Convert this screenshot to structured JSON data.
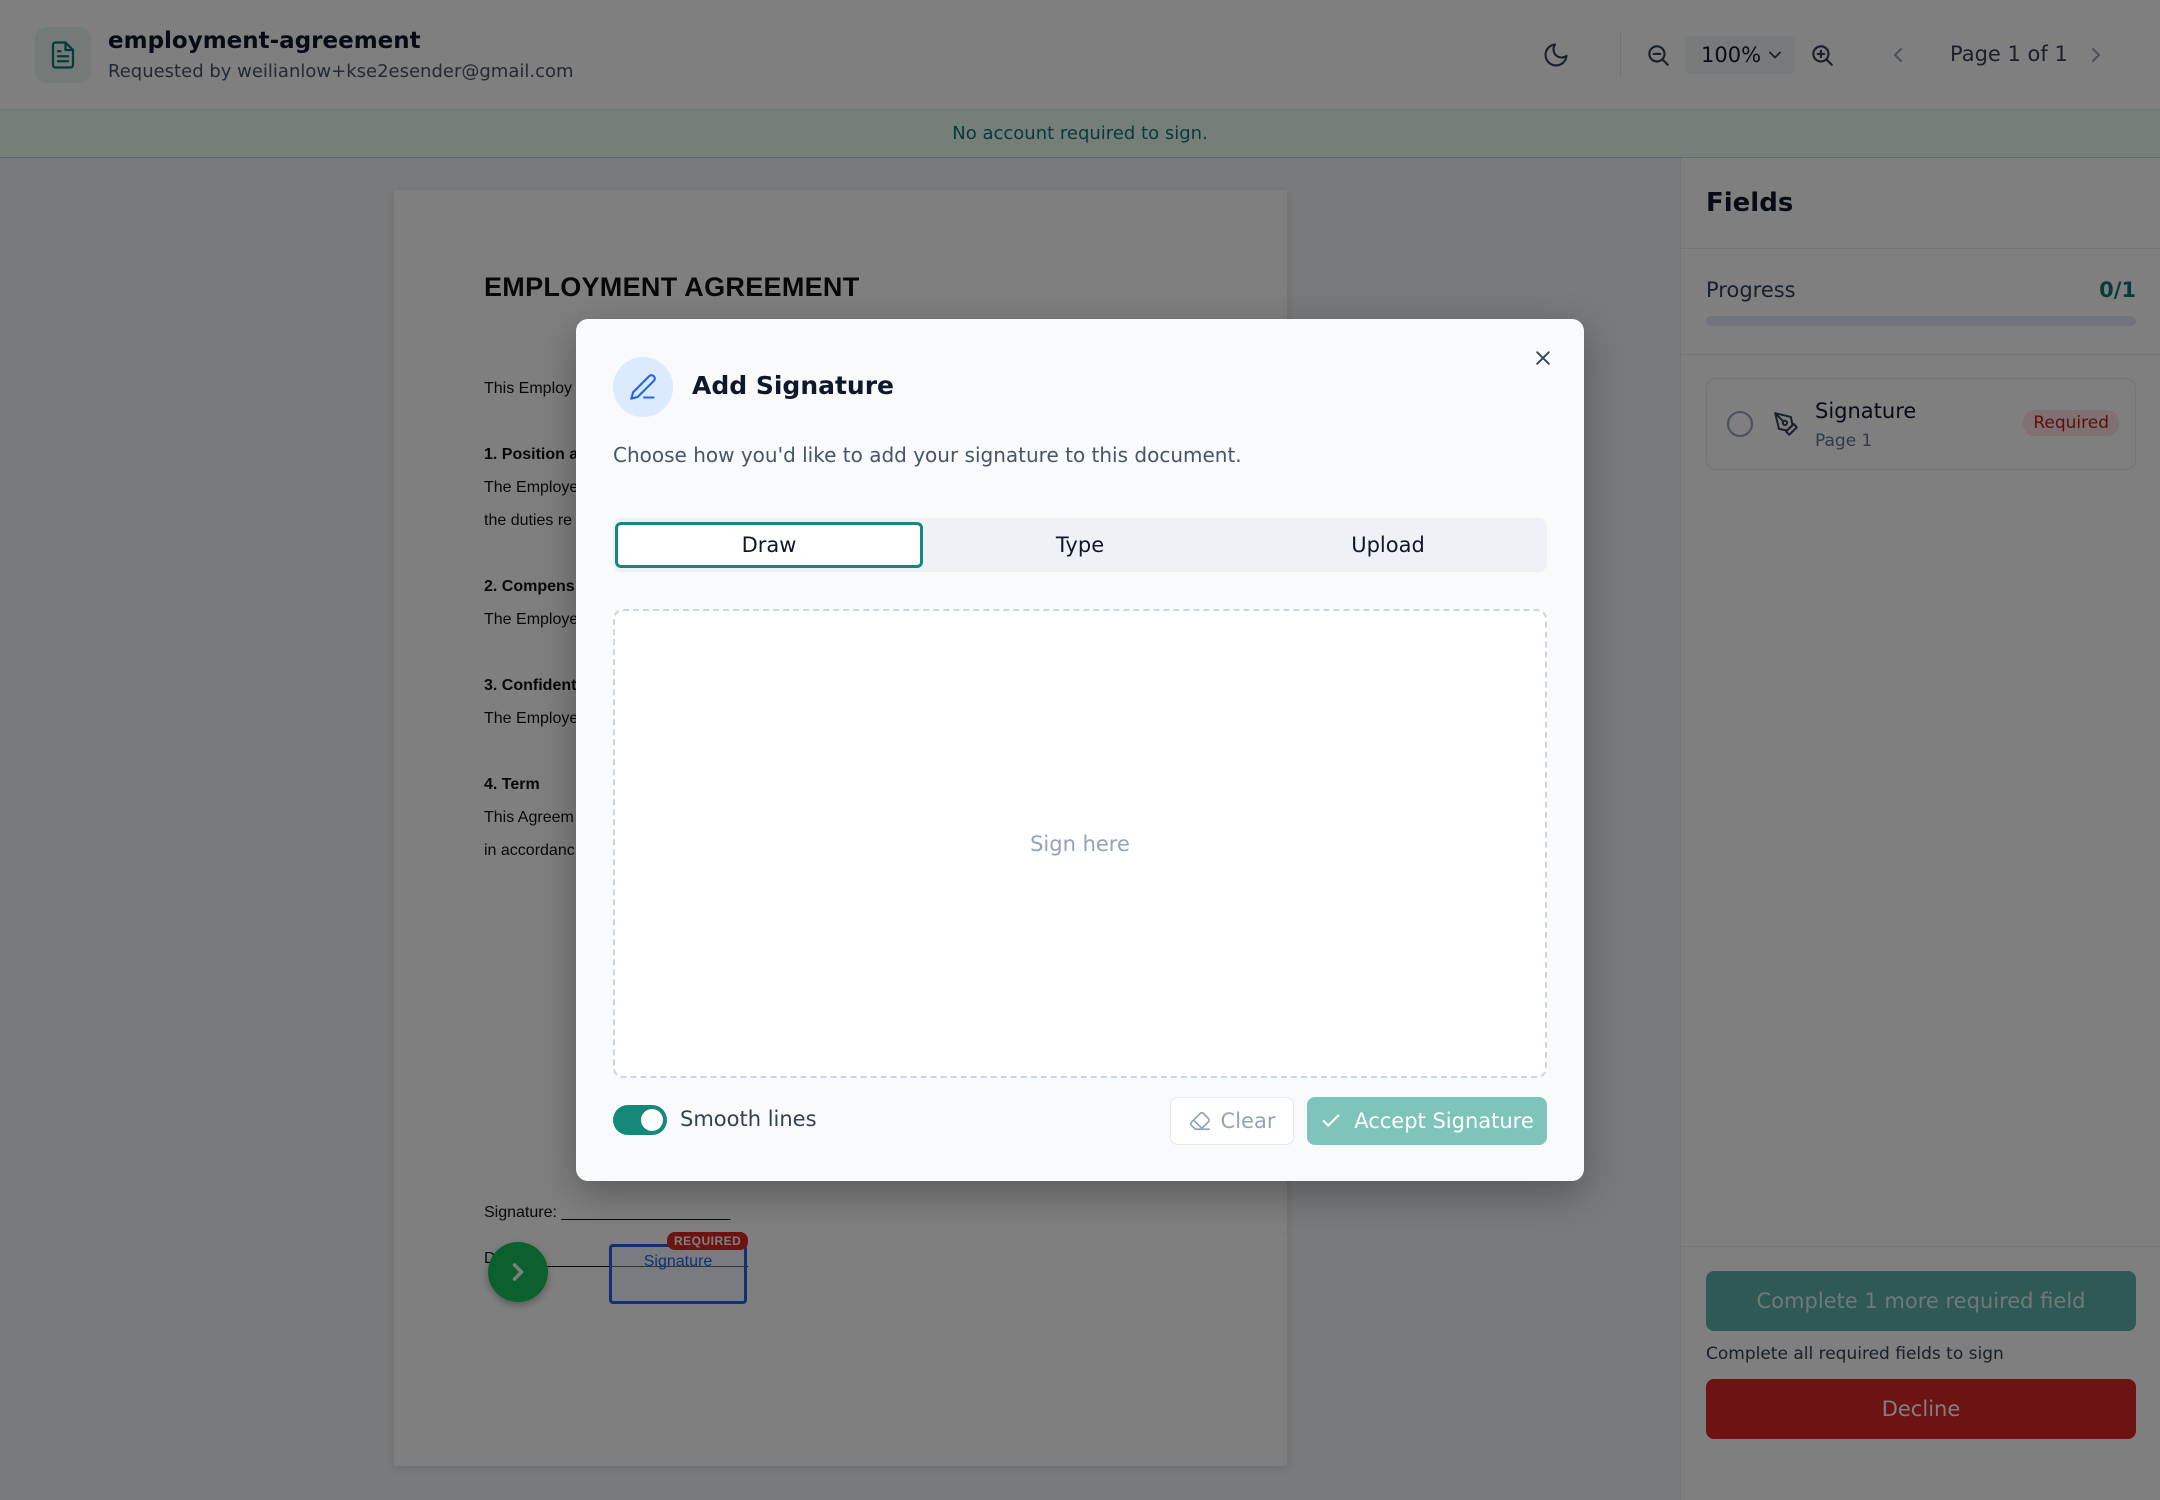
{
  "header": {
    "title": "employment-agreement",
    "subtitle": "Requested by weilianlow+kse2esender@gmail.com",
    "zoom_value": "100%",
    "page_label": "Page 1 of 1",
    "icons": [
      "document-icon",
      "moon-icon",
      "zoom-out-icon",
      "zoom-in-icon",
      "chevron-left-icon",
      "chevron-right-icon"
    ]
  },
  "banner": {
    "text": "No account required to sign."
  },
  "document": {
    "title": "EMPLOYMENT AGREEMENT",
    "lines": [
      {
        "text": "This Employ",
        "bold": false
      },
      {
        "text": "1. Position a",
        "bold": true
      },
      {
        "text": "The Employe",
        "bold": false
      },
      {
        "text": "the duties re",
        "bold": false
      },
      {
        "text": "2. Compens",
        "bold": true
      },
      {
        "text": "The Employe",
        "bold": false
      },
      {
        "text": "3. Confident",
        "bold": true
      },
      {
        "text": "The Employe",
        "bold": false
      },
      {
        "text": "4. Term",
        "bold": true
      },
      {
        "text": "This Agreem",
        "bold": false
      },
      {
        "text": "in accordanc",
        "bold": false
      }
    ],
    "signature_line_label": "Signature: ___________________",
    "date_line_label": "D",
    "signature_field": {
      "label": "Signature",
      "badge": "REQUIRED"
    }
  },
  "sidebar": {
    "title": "Fields",
    "progress_label": "Progress",
    "progress_count": "0/1",
    "progress_fraction": 0,
    "field": {
      "name": "Signature",
      "page": "Page 1",
      "status": "Required"
    },
    "complete_button": "Complete 1 more required field",
    "complete_hint": "Complete all required fields to sign",
    "decline_button": "Decline"
  },
  "modal": {
    "title": "Add Signature",
    "description": "Choose how you'd like to add your signature to this document.",
    "tabs": [
      {
        "label": "Draw",
        "active": true
      },
      {
        "label": "Type",
        "active": false
      },
      {
        "label": "Upload",
        "active": false
      }
    ],
    "canvas_placeholder": "Sign here",
    "smooth_lines_label": "Smooth lines",
    "smooth_lines_on": true,
    "clear_label": "Clear",
    "accept_label": "Accept Signature"
  },
  "colors": {
    "accent": "#14897a",
    "danger": "#dc2626",
    "next_button": "#16c35a"
  }
}
